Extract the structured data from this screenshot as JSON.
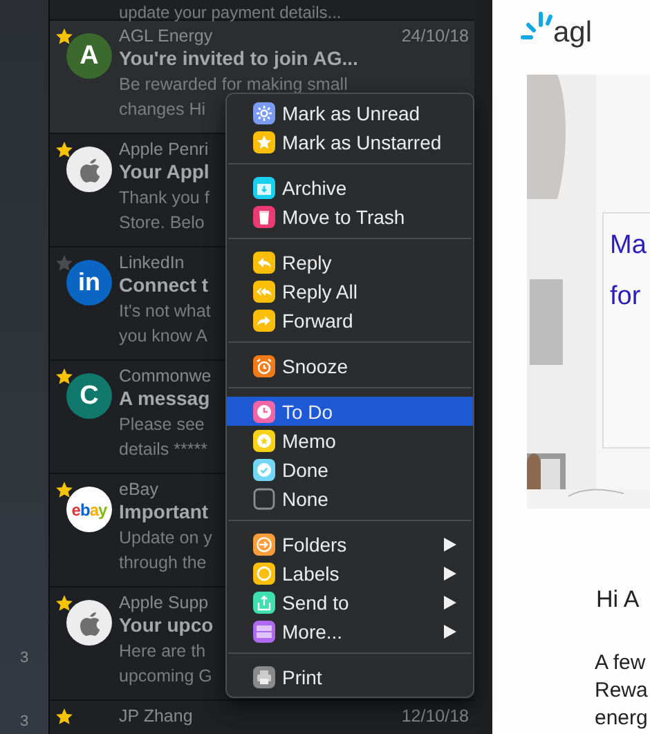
{
  "sidebar": {
    "counts": [
      "3",
      "3"
    ]
  },
  "mail_list": {
    "partial_top_preview": "update your payment details...",
    "messages": [
      {
        "sender": "AGL Energy",
        "date": "24/10/18",
        "subject": "You're invited to join AG...",
        "preview": [
          "Be rewarded for making small",
          "changes Hi"
        ],
        "starred": true,
        "selected": true,
        "avatar": {
          "kind": "letter",
          "text": "A",
          "color": "#3c6a2e"
        }
      },
      {
        "sender": "Apple Penri",
        "subject": "Your Appl",
        "preview": [
          "Thank you f",
          "Store. Belo"
        ],
        "starred": true,
        "selected": false,
        "avatar": {
          "kind": "apple"
        }
      },
      {
        "sender": "LinkedIn",
        "subject": "Connect t",
        "preview": [
          "It's not what",
          "you know A"
        ],
        "starred": false,
        "selected": false,
        "avatar": {
          "kind": "linkedin",
          "text": "in"
        }
      },
      {
        "sender": "Commonwe",
        "subject": "A messag",
        "preview": [
          "Please see",
          "details *****"
        ],
        "starred": true,
        "selected": false,
        "avatar": {
          "kind": "letter",
          "text": "C",
          "color": "#10786c"
        }
      },
      {
        "sender": "eBay",
        "subject": "Important",
        "preview": [
          "Update on y",
          "through the"
        ],
        "starred": true,
        "selected": false,
        "avatar": {
          "kind": "ebay",
          "text": "ebay"
        }
      },
      {
        "sender": "Apple Supp",
        "subject": "Your upco",
        "preview": [
          "Here are th",
          "upcoming G"
        ],
        "starred": true,
        "selected": false,
        "avatar": {
          "kind": "apple"
        }
      },
      {
        "sender": "JP Zhang",
        "date": "12/10/18",
        "starred": true,
        "selected": false
      }
    ]
  },
  "context_menu": {
    "sections": [
      [
        {
          "label": "Mark as Unread",
          "kind": "unread",
          "color": "#7b9cf5",
          "selected": false,
          "submenu": false
        },
        {
          "label": "Mark as Unstarred",
          "kind": "star",
          "color": "#fbbf0a",
          "selected": false,
          "submenu": false
        }
      ],
      [
        {
          "label": "Archive",
          "kind": "archive",
          "color": "#1ad0f0",
          "selected": false,
          "submenu": false
        },
        {
          "label": "Move to Trash",
          "kind": "trash",
          "color": "#ee3a72",
          "selected": false,
          "submenu": false
        }
      ],
      [
        {
          "label": "Reply",
          "kind": "reply",
          "color": "#fbbf0a",
          "selected": false,
          "submenu": false
        },
        {
          "label": "Reply All",
          "kind": "reply-all",
          "color": "#fbbf0a",
          "selected": false,
          "submenu": false
        },
        {
          "label": "Forward",
          "kind": "forward",
          "color": "#fbbf0a",
          "selected": false,
          "submenu": false
        }
      ],
      [
        {
          "label": "Snooze",
          "kind": "snooze",
          "color": "#f27a17",
          "selected": false,
          "submenu": false
        }
      ],
      [
        {
          "label": "To Do",
          "kind": "todo",
          "color": "#f266a8",
          "selected": true,
          "submenu": false
        },
        {
          "label": "Memo",
          "kind": "memo",
          "color": "#f8d21a",
          "selected": false,
          "submenu": false
        },
        {
          "label": "Done",
          "kind": "done",
          "color": "#72d6f6",
          "selected": false,
          "submenu": false
        },
        {
          "label": "None",
          "kind": "none",
          "selected": false,
          "submenu": false
        }
      ],
      [
        {
          "label": "Folders",
          "kind": "folders",
          "color": "#fb9d3c",
          "selected": false,
          "submenu": true
        },
        {
          "label": "Labels",
          "kind": "labels",
          "color": "#fbbf0a",
          "selected": false,
          "submenu": true
        },
        {
          "label": "Send to",
          "kind": "send",
          "color": "#3ee0b0",
          "selected": false,
          "submenu": true
        },
        {
          "label": "More...",
          "kind": "more",
          "color": "#b06af0",
          "selected": false,
          "submenu": true
        }
      ],
      [
        {
          "label": "Print",
          "kind": "print",
          "color": "#8a8a8a",
          "selected": false,
          "submenu": false
        }
      ]
    ]
  },
  "preview": {
    "logo_text": "agl",
    "headline": [
      "Ma",
      "for"
    ],
    "greeting": "Hi A",
    "body": [
      "A few",
      "Rewa",
      "energ"
    ]
  }
}
